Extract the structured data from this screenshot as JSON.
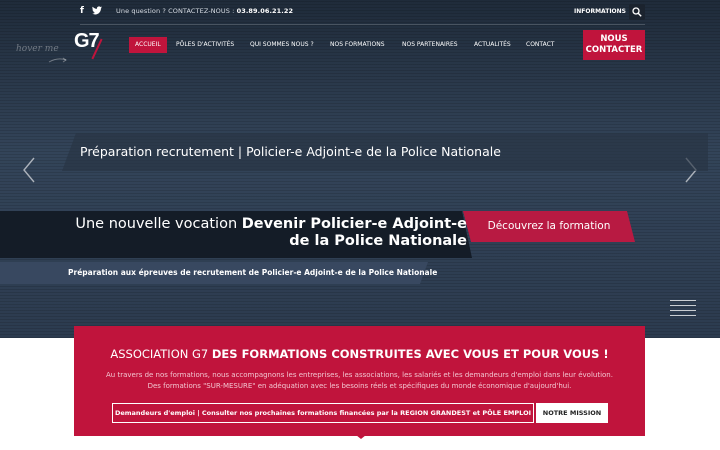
{
  "topbar": {
    "facebook_icon": "facebook-icon",
    "twitter_icon": "twitter-icon",
    "question_text": "Une question ? CONTACTEZ-NOUS : ",
    "phone": "03.89.06.21.22",
    "info_link": "INFORMATIONS",
    "search_icon": "search-icon"
  },
  "header": {
    "hover_hint": "hover me",
    "logo": "G7",
    "nav": [
      {
        "label": "ACCUEIL",
        "active": true
      },
      {
        "label": "PÔLES D'ACTIVITÉS"
      },
      {
        "label": "QUI SOMMES NOUS ?"
      },
      {
        "label": "NOS FORMATIONS"
      },
      {
        "label": "NOS PARTENAIRES"
      },
      {
        "label": "ACTUALITÉS"
      },
      {
        "label": "CONTACT"
      }
    ],
    "cta_line1": "NOUS",
    "cta_line2": "CONTACTER"
  },
  "hero": {
    "slide_title": "Préparation recrutement | Policier-e Adjoint-e de la Police Nationale",
    "vocation_prefix": "Une nouvelle vocation ",
    "vocation_bold": "Devenir Policier-e Adjoint-e de la Police Nationale",
    "discover_button": "Découvrez la formation",
    "subtitle": "Préparation aux épreuves de recrutement de Policier-e Adjoint-e de la Police Nationale"
  },
  "association": {
    "title_prefix": "ASSOCIATION G7 ",
    "title_bold": "DES FORMATIONS CONSTRUITES AVEC VOUS ET POUR VOUS !",
    "desc_line1": "Au travers de nos formations, nous accompagnons les entreprises, les associations, les salariés et les demandeurs d'emploi dans leur évolution.",
    "desc_line2": "Des formations \"SUR-MESURE\" en adéquation avec les besoins réels et spécifiques du monde économique d'aujourd'hui.",
    "btn_jobseekers": "Demandeurs d'emploi | Consulter nos prochaines formations financées par la REGION GRANDEST et PÔLE EMPLOI",
    "btn_mission": "NOTRE MISSION"
  },
  "colors": {
    "accent": "#c0143c",
    "hero_bg": "#2b3a4e",
    "banner_dark": "#141c27"
  }
}
